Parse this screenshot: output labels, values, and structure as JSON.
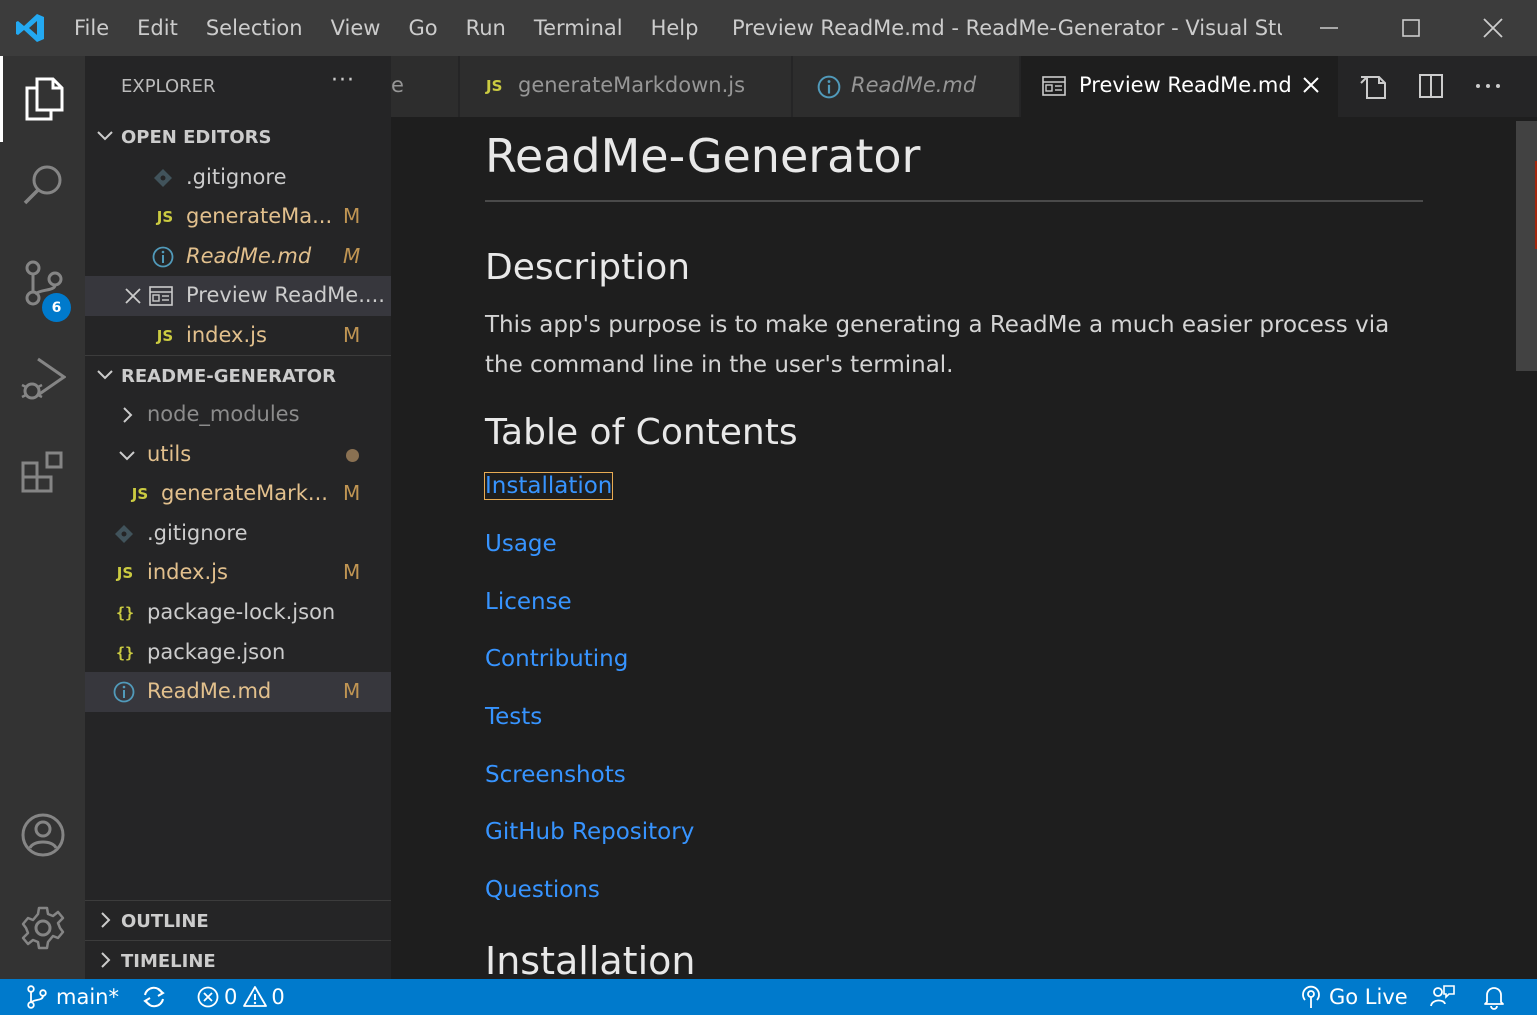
{
  "window": {
    "title": "Preview ReadMe.md - ReadMe-Generator - Visual Studi...",
    "menu": [
      "File",
      "Edit",
      "Selection",
      "View",
      "Go",
      "Run",
      "Terminal",
      "Help"
    ]
  },
  "activity_bar": {
    "items": [
      {
        "name": "explorer-icon",
        "active": true
      },
      {
        "name": "search-icon"
      },
      {
        "name": "source-control-icon",
        "badge": "6"
      },
      {
        "name": "run-debug-icon"
      },
      {
        "name": "extensions-icon"
      }
    ],
    "bottom": [
      "account-icon",
      "settings-gear-icon"
    ]
  },
  "sidebar": {
    "title": "EXPLORER",
    "more": "···",
    "open_editors": {
      "label": "OPEN EDITORS",
      "items": [
        {
          "icon": "git-icon",
          "name": ".gitignore",
          "mark": ""
        },
        {
          "icon": "JS",
          "name": "generateMa...",
          "mark": "M"
        },
        {
          "icon": "info-icon",
          "name": "ReadMe.md",
          "mark": "M"
        },
        {
          "icon": "preview-icon",
          "name": "Preview ReadMe....",
          "mark": ""
        },
        {
          "icon": "JS",
          "name": "index.js",
          "mark": "M"
        }
      ]
    },
    "project": {
      "label": "README-GENERATOR",
      "items": [
        {
          "icon": "chevron-right",
          "name": "node_modules",
          "mark": ""
        },
        {
          "icon": "chevron-down",
          "name": "utils",
          "mark": ""
        },
        {
          "icon": "JS",
          "name": "generateMark...",
          "mark": "M"
        },
        {
          "icon": "git-icon",
          "name": ".gitignore",
          "mark": ""
        },
        {
          "icon": "JS",
          "name": "index.js",
          "mark": "M"
        },
        {
          "icon": "{}",
          "name": "package-lock.json",
          "mark": ""
        },
        {
          "icon": "{}",
          "name": "package.json",
          "mark": ""
        },
        {
          "icon": "info-icon",
          "name": "ReadMe.md",
          "mark": "M"
        }
      ]
    },
    "outline_label": "OUTLINE",
    "timeline_label": "TIMELINE"
  },
  "tabs": [
    {
      "label": "e",
      "icon": ""
    },
    {
      "label": "generateMarkdown.js",
      "icon": "JS"
    },
    {
      "label": "ReadMe.md",
      "icon": "info-icon"
    },
    {
      "label": "Preview ReadMe.md",
      "icon": "preview-icon",
      "active": true
    }
  ],
  "preview": {
    "title": "ReadMe-Generator",
    "description_heading": "Description",
    "description_text": "This app's purpose is to make generating a ReadMe a much easier process via the command line in the user's terminal.",
    "toc_heading": "Table of Contents",
    "toc_links": [
      "Installation",
      "Usage",
      "License",
      "Contributing",
      "Tests",
      "Screenshots",
      "GitHub Repository",
      "Questions"
    ],
    "installation_heading": "Installation"
  },
  "status_bar": {
    "branch": "main*",
    "errors": "0",
    "warnings": "0",
    "go_live": "Go Live"
  },
  "colors": {
    "accent": "#007acc",
    "modified": "#c09553",
    "link": "#3794ff",
    "js": "#cbcb41"
  }
}
